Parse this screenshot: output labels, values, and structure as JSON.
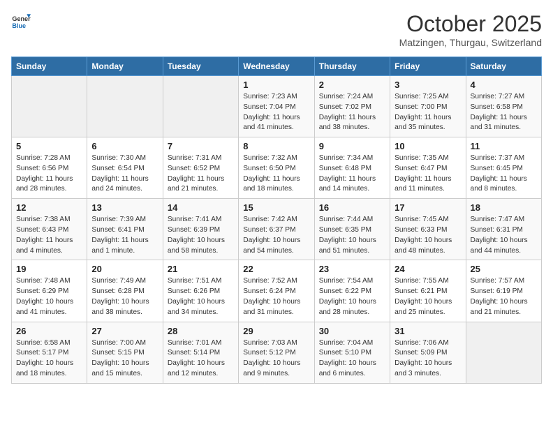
{
  "header": {
    "logo_general": "General",
    "logo_blue": "Blue",
    "month": "October 2025",
    "location": "Matzingen, Thurgau, Switzerland"
  },
  "days_of_week": [
    "Sunday",
    "Monday",
    "Tuesday",
    "Wednesday",
    "Thursday",
    "Friday",
    "Saturday"
  ],
  "weeks": [
    [
      {
        "day": "",
        "info": ""
      },
      {
        "day": "",
        "info": ""
      },
      {
        "day": "",
        "info": ""
      },
      {
        "day": "1",
        "info": "Sunrise: 7:23 AM\nSunset: 7:04 PM\nDaylight: 11 hours and 41 minutes."
      },
      {
        "day": "2",
        "info": "Sunrise: 7:24 AM\nSunset: 7:02 PM\nDaylight: 11 hours and 38 minutes."
      },
      {
        "day": "3",
        "info": "Sunrise: 7:25 AM\nSunset: 7:00 PM\nDaylight: 11 hours and 35 minutes."
      },
      {
        "day": "4",
        "info": "Sunrise: 7:27 AM\nSunset: 6:58 PM\nDaylight: 11 hours and 31 minutes."
      }
    ],
    [
      {
        "day": "5",
        "info": "Sunrise: 7:28 AM\nSunset: 6:56 PM\nDaylight: 11 hours and 28 minutes."
      },
      {
        "day": "6",
        "info": "Sunrise: 7:30 AM\nSunset: 6:54 PM\nDaylight: 11 hours and 24 minutes."
      },
      {
        "day": "7",
        "info": "Sunrise: 7:31 AM\nSunset: 6:52 PM\nDaylight: 11 hours and 21 minutes."
      },
      {
        "day": "8",
        "info": "Sunrise: 7:32 AM\nSunset: 6:50 PM\nDaylight: 11 hours and 18 minutes."
      },
      {
        "day": "9",
        "info": "Sunrise: 7:34 AM\nSunset: 6:48 PM\nDaylight: 11 hours and 14 minutes."
      },
      {
        "day": "10",
        "info": "Sunrise: 7:35 AM\nSunset: 6:47 PM\nDaylight: 11 hours and 11 minutes."
      },
      {
        "day": "11",
        "info": "Sunrise: 7:37 AM\nSunset: 6:45 PM\nDaylight: 11 hours and 8 minutes."
      }
    ],
    [
      {
        "day": "12",
        "info": "Sunrise: 7:38 AM\nSunset: 6:43 PM\nDaylight: 11 hours and 4 minutes."
      },
      {
        "day": "13",
        "info": "Sunrise: 7:39 AM\nSunset: 6:41 PM\nDaylight: 11 hours and 1 minute."
      },
      {
        "day": "14",
        "info": "Sunrise: 7:41 AM\nSunset: 6:39 PM\nDaylight: 10 hours and 58 minutes."
      },
      {
        "day": "15",
        "info": "Sunrise: 7:42 AM\nSunset: 6:37 PM\nDaylight: 10 hours and 54 minutes."
      },
      {
        "day": "16",
        "info": "Sunrise: 7:44 AM\nSunset: 6:35 PM\nDaylight: 10 hours and 51 minutes."
      },
      {
        "day": "17",
        "info": "Sunrise: 7:45 AM\nSunset: 6:33 PM\nDaylight: 10 hours and 48 minutes."
      },
      {
        "day": "18",
        "info": "Sunrise: 7:47 AM\nSunset: 6:31 PM\nDaylight: 10 hours and 44 minutes."
      }
    ],
    [
      {
        "day": "19",
        "info": "Sunrise: 7:48 AM\nSunset: 6:29 PM\nDaylight: 10 hours and 41 minutes."
      },
      {
        "day": "20",
        "info": "Sunrise: 7:49 AM\nSunset: 6:28 PM\nDaylight: 10 hours and 38 minutes."
      },
      {
        "day": "21",
        "info": "Sunrise: 7:51 AM\nSunset: 6:26 PM\nDaylight: 10 hours and 34 minutes."
      },
      {
        "day": "22",
        "info": "Sunrise: 7:52 AM\nSunset: 6:24 PM\nDaylight: 10 hours and 31 minutes."
      },
      {
        "day": "23",
        "info": "Sunrise: 7:54 AM\nSunset: 6:22 PM\nDaylight: 10 hours and 28 minutes."
      },
      {
        "day": "24",
        "info": "Sunrise: 7:55 AM\nSunset: 6:21 PM\nDaylight: 10 hours and 25 minutes."
      },
      {
        "day": "25",
        "info": "Sunrise: 7:57 AM\nSunset: 6:19 PM\nDaylight: 10 hours and 21 minutes."
      }
    ],
    [
      {
        "day": "26",
        "info": "Sunrise: 6:58 AM\nSunset: 5:17 PM\nDaylight: 10 hours and 18 minutes."
      },
      {
        "day": "27",
        "info": "Sunrise: 7:00 AM\nSunset: 5:15 PM\nDaylight: 10 hours and 15 minutes."
      },
      {
        "day": "28",
        "info": "Sunrise: 7:01 AM\nSunset: 5:14 PM\nDaylight: 10 hours and 12 minutes."
      },
      {
        "day": "29",
        "info": "Sunrise: 7:03 AM\nSunset: 5:12 PM\nDaylight: 10 hours and 9 minutes."
      },
      {
        "day": "30",
        "info": "Sunrise: 7:04 AM\nSunset: 5:10 PM\nDaylight: 10 hours and 6 minutes."
      },
      {
        "day": "31",
        "info": "Sunrise: 7:06 AM\nSunset: 5:09 PM\nDaylight: 10 hours and 3 minutes."
      },
      {
        "day": "",
        "info": ""
      }
    ]
  ]
}
